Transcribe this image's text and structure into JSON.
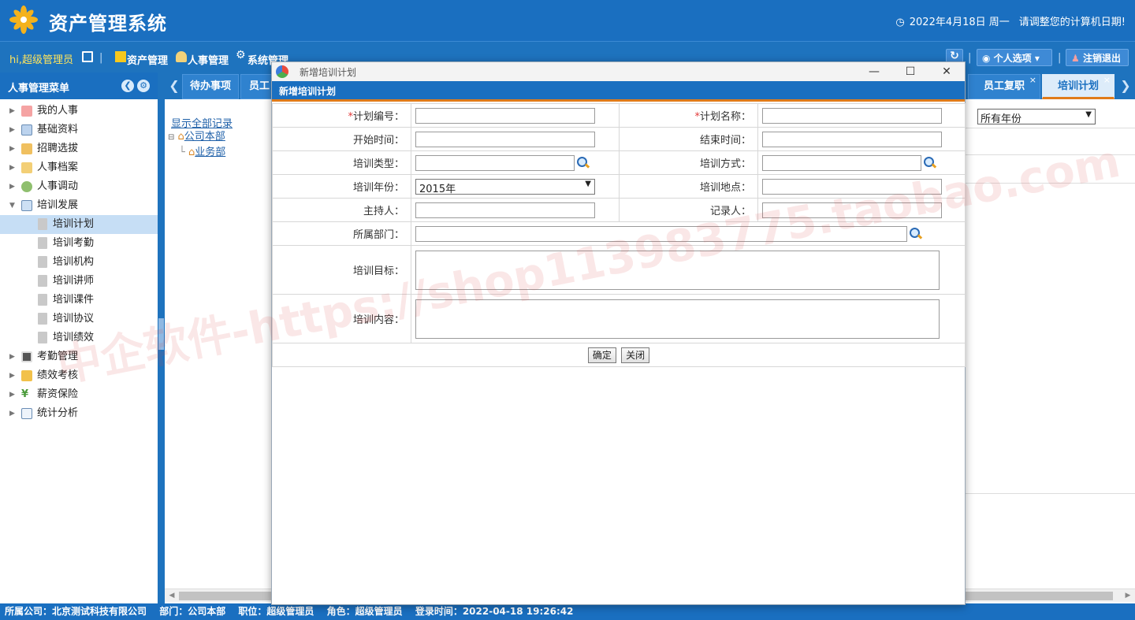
{
  "header": {
    "app_title": "资产管理系统",
    "date": "2022年4月18日 周一",
    "notice": "请调整您的计算机日期!"
  },
  "toolbar": {
    "greeting": "hi,超级管理员",
    "menu": [
      "资产管理",
      "人事管理",
      "系统管理"
    ],
    "personal_options": "个人选项",
    "logout": "注销退出"
  },
  "sidebar": {
    "title": "人事管理菜单",
    "items": [
      {
        "label": "我的人事",
        "expanded": false
      },
      {
        "label": "基础资料",
        "expanded": false
      },
      {
        "label": "招聘选拔",
        "expanded": false
      },
      {
        "label": "人事档案",
        "expanded": false
      },
      {
        "label": "人事调动",
        "expanded": false
      },
      {
        "label": "培训发展",
        "expanded": true,
        "children": [
          "培训计划",
          "培训考勤",
          "培训机构",
          "培训讲师",
          "培训课件",
          "培训协议",
          "培训绩效"
        ],
        "active_child": "培训计划"
      },
      {
        "label": "考勤管理",
        "expanded": false
      },
      {
        "label": "绩效考核",
        "expanded": false
      },
      {
        "label": "薪资保险",
        "expanded": false
      },
      {
        "label": "统计分析",
        "expanded": false
      }
    ]
  },
  "tabs": {
    "left": [
      "待办事项",
      "员工"
    ],
    "right": [
      "员工复职",
      "培训计划"
    ],
    "active": "培训计划"
  },
  "content": {
    "show_all": "显示全部记录",
    "org_root": "公司本部",
    "org_child": "业务部",
    "year_filter": "所有年份"
  },
  "modal": {
    "window_title": "新增培训计划",
    "header": "新增培训计划",
    "fields": {
      "plan_no": "计划编号：",
      "plan_name": "计划名称：",
      "start_time": "开始时间：",
      "end_time": "结束时间：",
      "training_type": "培训类型：",
      "training_method": "培训方式：",
      "training_year": "培训年份：",
      "training_year_value": "2015年",
      "training_place": "培训地点：",
      "host": "主持人：",
      "recorder": "记录人：",
      "department": "所属部门：",
      "goal": "培训目标：",
      "content": "培训内容："
    },
    "required_mark": "*",
    "confirm": "确定",
    "close": "关闭"
  },
  "watermark": "中企软件-https://shop113983775.taobao.com",
  "statusbar": {
    "company": "所属公司：北京测试科技有限公司",
    "dept": "部门：公司本部",
    "position": "职位：超级管理员",
    "role": "角色：超级管理员",
    "login_time": "登录时间：2022-04-18 19:26:42"
  },
  "colors": {
    "primary": "#1a6fc0",
    "accent_orange": "#e07b1a",
    "link": "#1d5fa8",
    "greeting": "#ffe45c"
  }
}
